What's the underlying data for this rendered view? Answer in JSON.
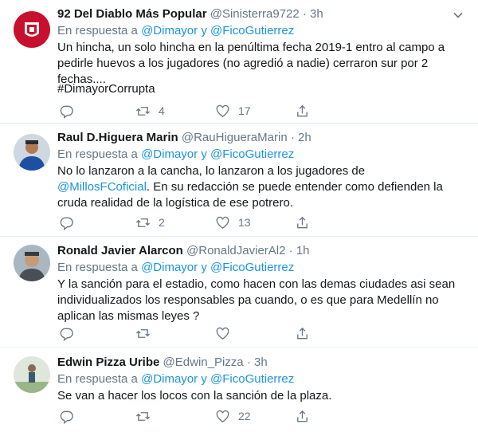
{
  "reply_prefix": "En respuesta a",
  "reply_and": "y",
  "colors": {
    "link": "#1b95e0",
    "muted": "#657786",
    "divider": "#e6ecf0"
  },
  "tweets": [
    {
      "name": "92 Del Diablo Más Popular",
      "handle": "@Sinisterra9722",
      "sep": "·",
      "time": "3h",
      "mention1": "@Dimayor",
      "mention2": "@FicoGutierrez",
      "text": "Un hincha, un solo hincha en la penúltima fecha 2019-1 entro al campo a pedirle huevos a los jugadores (no agredió a nadie) cerraron sur por 2 fechas....",
      "hashtag": "#DimayorCorrupta",
      "retweets": "4",
      "likes": "17"
    },
    {
      "name": "Raul D.Higuera Marin",
      "handle": "@RauHigueraMarin",
      "sep": "·",
      "time": "2h",
      "mention1": "@Dimayor",
      "mention2": "@FicoGutierrez",
      "text_before": "No lo lanzaron a la cancha, lo lanzaron a los jugadores de ",
      "text_mention": "@MillosFCoficial",
      "text_after": ". En su redacción se puede entender como defienden la cruda realidad de la logística de ese potrero.",
      "retweets": "2",
      "likes": "13"
    },
    {
      "name": "Ronald Javier Alarcon",
      "handle": "@RonaldJavierAl2",
      "sep": "·",
      "time": "1h",
      "mention1": "@Dimayor",
      "mention2": "@FicoGutierrez",
      "text": "Y la sanción para el estadio, como hacen con las demas ciudades asi sean individualizados los responsables pa cuando, o es que para Medellín no aplican las mismas leyes ?",
      "retweets": "",
      "likes": ""
    },
    {
      "name": "Edwin Pizza Uribe",
      "handle": "@Edwin_Pizza",
      "sep": "·",
      "time": "3h",
      "mention1": "@Dimayor",
      "mention2": "@FicoGutierrez",
      "text": "Se van a hacer los locos con la sanción de la plaza.",
      "retweets": "",
      "likes": "22"
    }
  ]
}
